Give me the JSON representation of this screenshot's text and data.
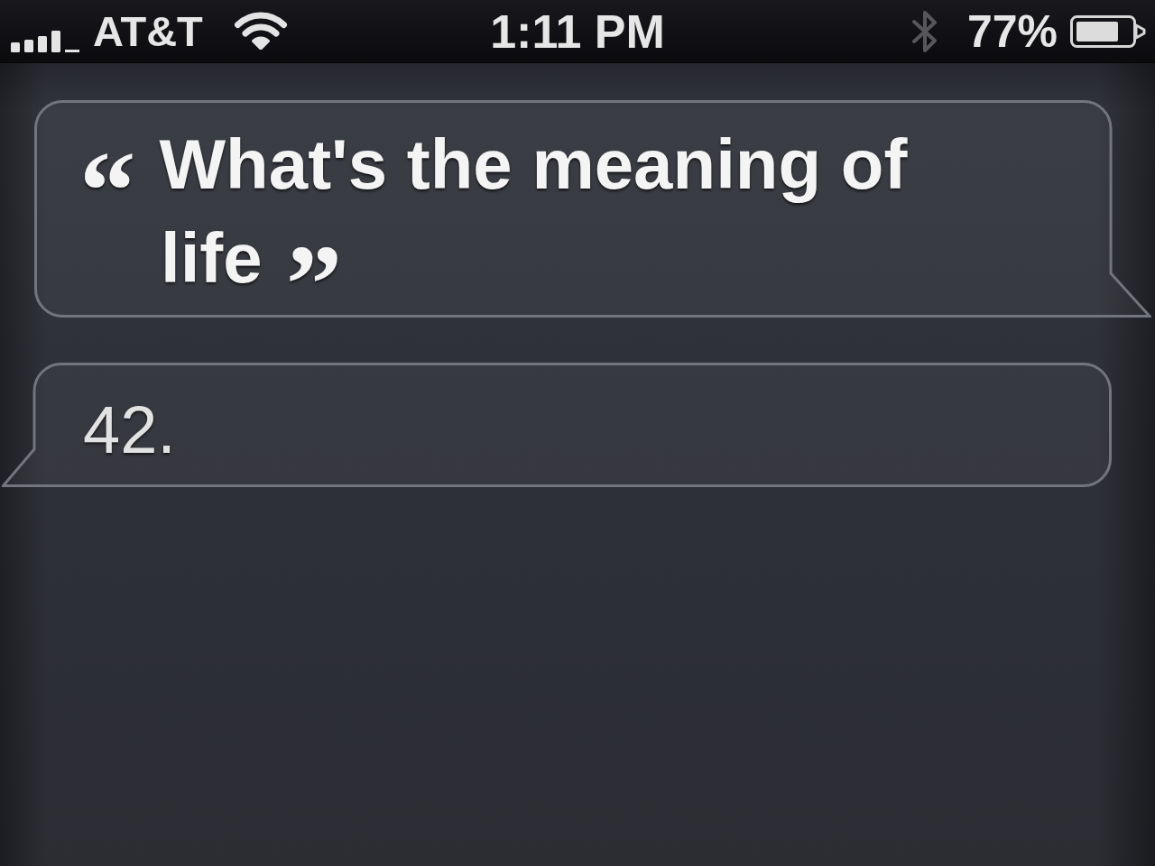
{
  "status_bar": {
    "carrier": "AT&T",
    "time": "1:11 PM",
    "battery_percent": "77%"
  },
  "conversation": [
    {
      "kind": "query",
      "open_mark": "“",
      "text": "What's the meaning of life",
      "close_mark": "”"
    },
    {
      "kind": "response",
      "text": "42."
    }
  ]
}
